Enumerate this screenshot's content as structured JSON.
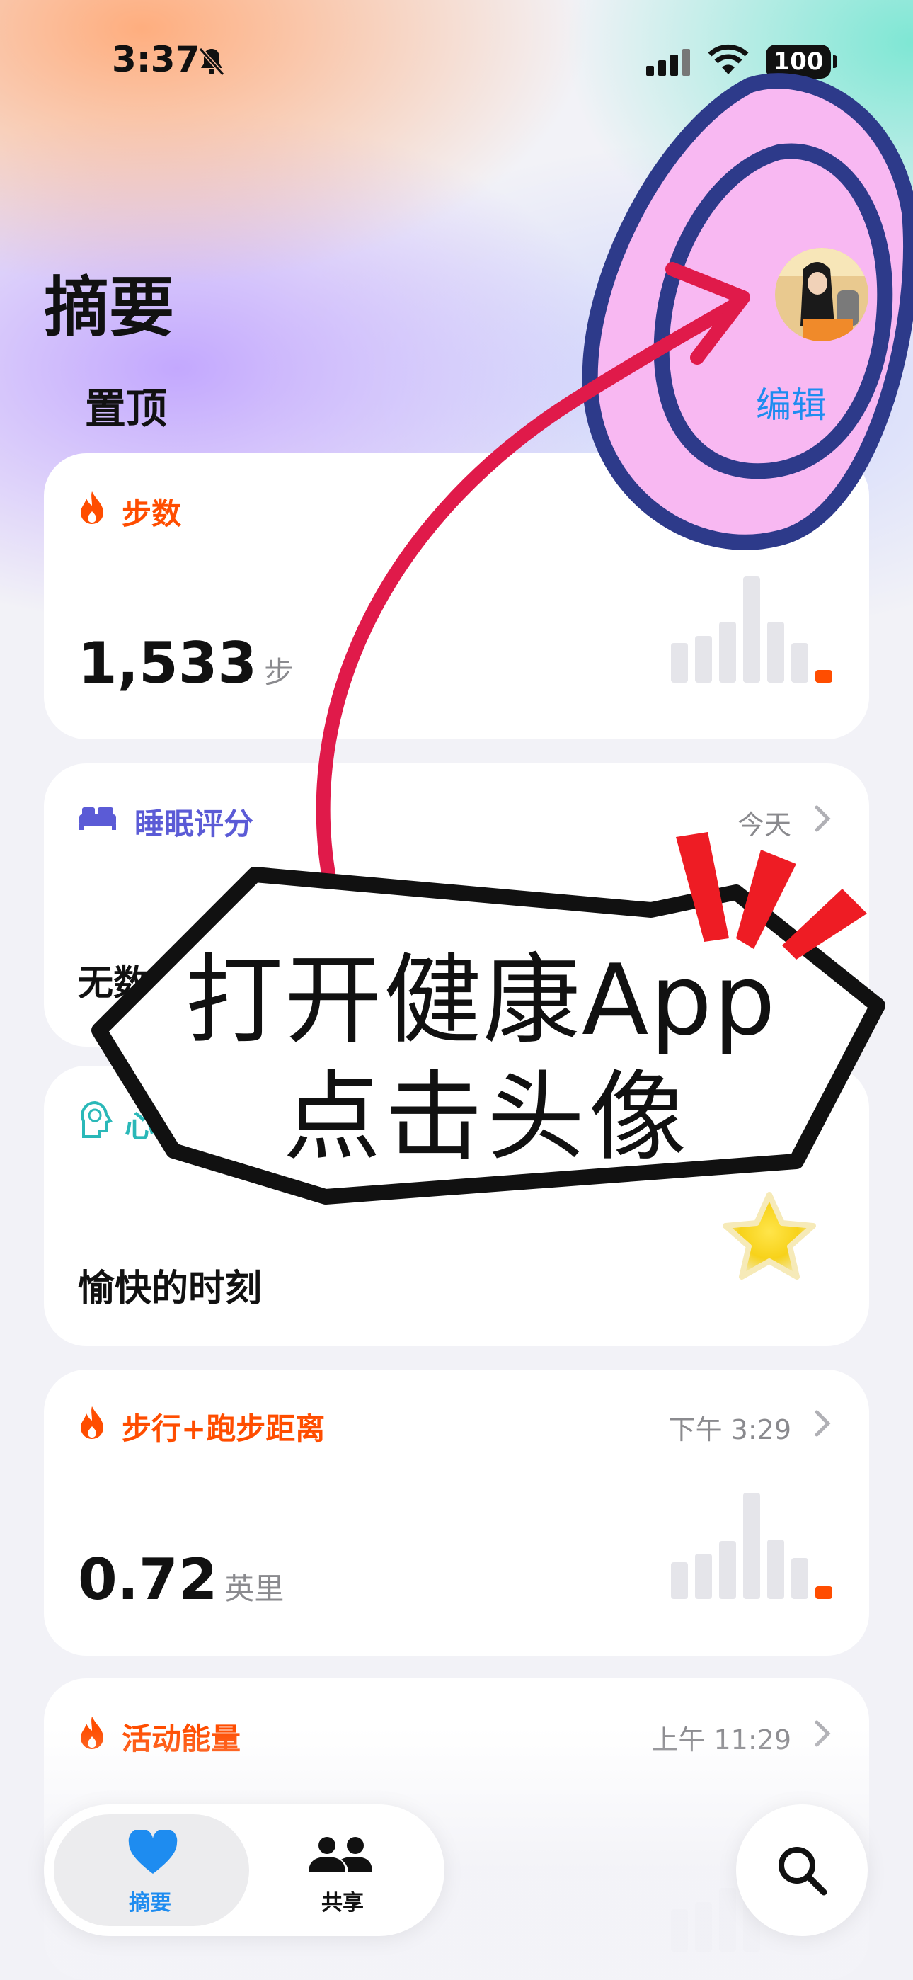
{
  "status_bar": {
    "time": "3:37",
    "battery": "100"
  },
  "header": {
    "title": "摘要",
    "section": "置顶",
    "edit_label": "编辑"
  },
  "cards": [
    {
      "label": "步数",
      "color": "#ff4d00",
      "value": "1,533",
      "unit": "步",
      "time": "",
      "icon": "flame-icon"
    },
    {
      "label": "睡眠评分",
      "color": "#5b5bd6",
      "value": "无数据",
      "unit": "",
      "time": "今天",
      "icon": "bed-icon"
    },
    {
      "label": "心理健康",
      "color": "#2ab8b8",
      "value": "愉快的时刻",
      "unit": "",
      "time": "",
      "icon": "brain-icon"
    },
    {
      "label": "步行+跑步距离",
      "color": "#ff4d00",
      "value": "0.72",
      "unit": "英里",
      "time": "下午 3:29",
      "icon": "flame-icon"
    },
    {
      "label": "活动能量",
      "color": "#ff4d00",
      "value": "",
      "unit": "",
      "time": "上午 11:29",
      "icon": "flame-icon"
    }
  ],
  "tabs": [
    {
      "label": "摘要",
      "icon": "heart-icon",
      "active": true
    },
    {
      "label": "共享",
      "icon": "people-icon",
      "active": false
    }
  ],
  "annotation": {
    "line1": "打开健康App",
    "line2": "点击头像"
  }
}
